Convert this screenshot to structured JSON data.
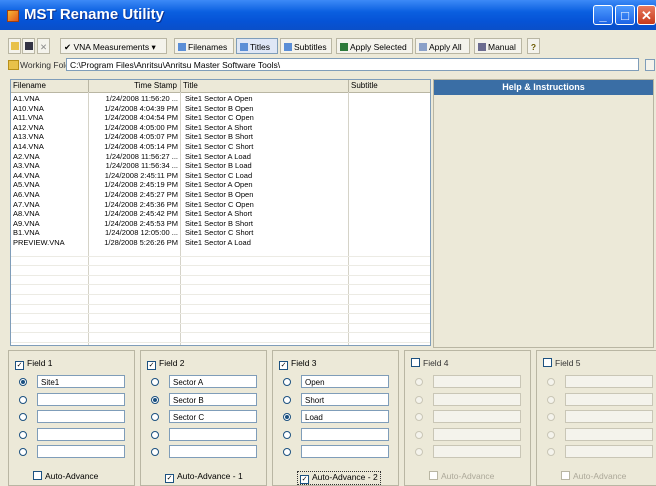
{
  "window": {
    "title": "MST Rename Utility"
  },
  "toolbar": {
    "vna_measurements": "VNA Measurements",
    "filenames": "Filenames",
    "titles": "Titles",
    "subtitles": "Subtitles",
    "apply_selected": "Apply Selected",
    "apply_all": "Apply All",
    "manual": "Manual"
  },
  "working_folder": {
    "label": "Working Folder:",
    "value": "C:\\Program Files\\Anritsu\\Anritsu Master Software Tools\\"
  },
  "table": {
    "columns": [
      "Filename",
      "Time Stamp",
      "Title",
      "Subtitle"
    ],
    "rows": [
      {
        "filename": "A1.VNA",
        "time": "1/24/2008 11:56:20 ...",
        "title": "Site1 Sector A Open"
      },
      {
        "filename": "A10.VNA",
        "time": "1/24/2008 4:04:39 PM",
        "title": "Site1 Sector B Open"
      },
      {
        "filename": "A11.VNA",
        "time": "1/24/2008 4:04:54 PM",
        "title": "Site1 Sector C Open"
      },
      {
        "filename": "A12.VNA",
        "time": "1/24/2008 4:05:00 PM",
        "title": "Site1 Sector A Short"
      },
      {
        "filename": "A13.VNA",
        "time": "1/24/2008 4:05:07 PM",
        "title": "Site1 Sector B Short"
      },
      {
        "filename": "A14.VNA",
        "time": "1/24/2008 4:05:14 PM",
        "title": "Site1 Sector C Short"
      },
      {
        "filename": "A2.VNA",
        "time": "1/24/2008 11:56:27 ...",
        "title": "Site1 Sector A Load"
      },
      {
        "filename": "A3.VNA",
        "time": "1/24/2008 11:56:34 ...",
        "title": "Site1 Sector B Load"
      },
      {
        "filename": "A4.VNA",
        "time": "1/24/2008 2:45:11 PM",
        "title": "Site1 Sector C Load"
      },
      {
        "filename": "A5.VNA",
        "time": "1/24/2008 2:45:19 PM",
        "title": "Site1 Sector A Open"
      },
      {
        "filename": "A6.VNA",
        "time": "1/24/2008 2:45:27 PM",
        "title": "Site1 Sector B Open"
      },
      {
        "filename": "A7.VNA",
        "time": "1/24/2008 2:45:36 PM",
        "title": "Site1 Sector C Open"
      },
      {
        "filename": "A8.VNA",
        "time": "1/24/2008 2:45:42 PM",
        "title": "Site1 Sector A Short"
      },
      {
        "filename": "A9.VNA",
        "time": "1/24/2008 2:45:53 PM",
        "title": "Site1 Sector B Short"
      },
      {
        "filename": "B1.VNA",
        "time": "1/24/2008 12:05:00 ...",
        "title": "Site1 Sector C Short"
      },
      {
        "filename": "PREVIEW.VNA",
        "time": "1/28/2008 5:26:26 PM",
        "title": "Site1 Sector A Load"
      }
    ]
  },
  "help": {
    "title": "Help & Instructions"
  },
  "fields": [
    {
      "label": "Field 1",
      "checked": true,
      "values": [
        "Site1",
        "",
        "",
        "",
        ""
      ],
      "selected": 0,
      "auto_advance": "Auto-Advance",
      "aa_checked": false,
      "enabled": true
    },
    {
      "label": "Field 2",
      "checked": true,
      "values": [
        "Sector A",
        "Sector B",
        "Sector C",
        "",
        ""
      ],
      "selected": 1,
      "auto_advance": "Auto-Advance - 1",
      "aa_checked": true,
      "enabled": true
    },
    {
      "label": "Field 3",
      "checked": true,
      "values": [
        "Open",
        "Short",
        "Load",
        "",
        ""
      ],
      "selected": 2,
      "auto_advance": "Auto-Advance - 2",
      "aa_checked": true,
      "enabled": true
    },
    {
      "label": "Field 4",
      "checked": false,
      "values": [
        "",
        "",
        "",
        "",
        ""
      ],
      "selected": 0,
      "auto_advance": "Auto-Advance",
      "aa_checked": false,
      "enabled": false
    },
    {
      "label": "Field 5",
      "checked": false,
      "values": [
        "",
        "",
        "",
        "",
        ""
      ],
      "selected": 0,
      "auto_advance": "Auto-Advance",
      "aa_checked": false,
      "enabled": false
    }
  ]
}
